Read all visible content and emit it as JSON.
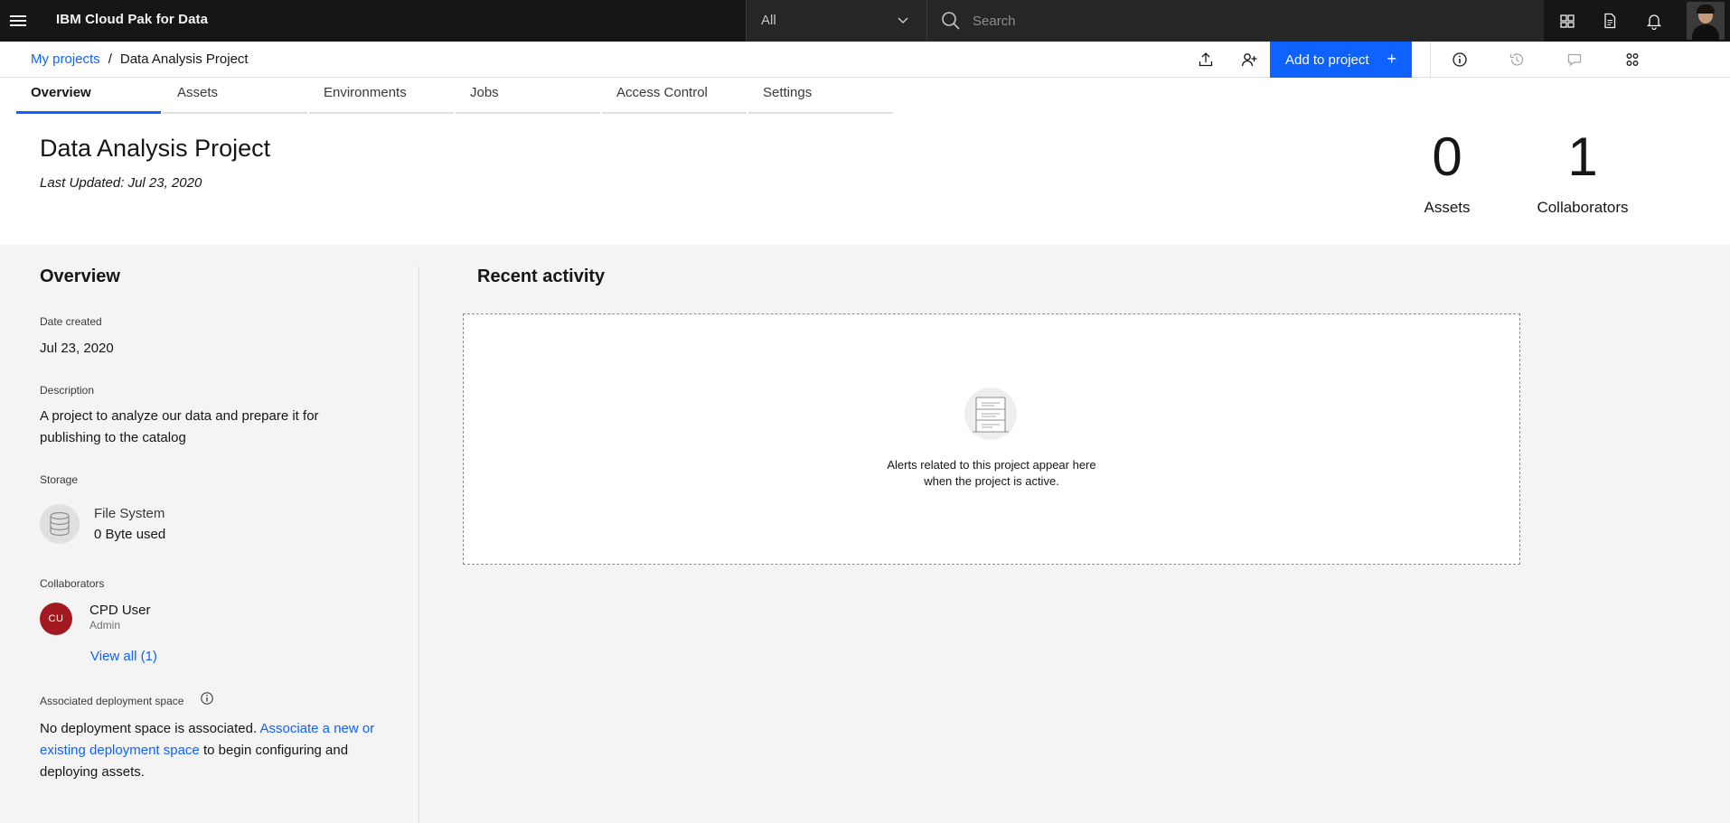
{
  "header": {
    "app_title": "IBM Cloud Pak for Data",
    "scope_select": {
      "selected": "All"
    },
    "search": {
      "placeholder": "Search",
      "value": ""
    },
    "icons": [
      "menu-icon",
      "catalog-icon",
      "document-icon",
      "notification-icon",
      "user-avatar"
    ]
  },
  "breadcrumb": {
    "root": "My projects",
    "separator": "/",
    "current": "Data Analysis Project"
  },
  "toolbar": {
    "add_button_label": "Add to project",
    "add_button_icon": "+",
    "icons": [
      "export-icon",
      "add-collaborator-icon",
      "info-icon",
      "history-icon",
      "chat-icon",
      "settings-icon"
    ]
  },
  "tabs": [
    {
      "label": "Overview",
      "active": true
    },
    {
      "label": "Assets",
      "active": false
    },
    {
      "label": "Environments",
      "active": false
    },
    {
      "label": "Jobs",
      "active": false
    },
    {
      "label": "Access Control",
      "active": false
    },
    {
      "label": "Settings",
      "active": false
    }
  ],
  "project": {
    "title": "Data Analysis Project",
    "last_updated": "Last Updated: Jul 23, 2020",
    "stats": {
      "assets": {
        "value": "0",
        "label": "Assets"
      },
      "collaborators": {
        "value": "1",
        "label": "Collaborators"
      }
    }
  },
  "overview": {
    "title": "Overview",
    "date_created": {
      "label": "Date created",
      "value": "Jul 23, 2020"
    },
    "description": {
      "label": "Description",
      "line1": "A project to analyze our data and prepare it for",
      "line2": "publishing to the catalog"
    },
    "storage": {
      "label": "Storage",
      "type": "File System",
      "usage": "0 Byte used"
    },
    "collaborators": {
      "label": "Collaborators",
      "items": [
        {
          "initials": "CU",
          "name": "CPD User",
          "role": "Admin"
        }
      ],
      "view_all": "View all (1)"
    },
    "deployment_space": {
      "label": "Associated deployment space",
      "text_before": "No deployment space is associated.",
      "link_line1": "Associate a new or",
      "link_line2": "existing deployment space",
      "text_after_1": "to begin configuring and",
      "text_after_2": "deploying assets."
    }
  },
  "recent_activity": {
    "title": "Recent activity",
    "empty_line1": "Alerts related to this project appear here",
    "empty_line2": "when the project is active."
  },
  "colors": {
    "header_bg": "#161616",
    "primary": "#0f62fe",
    "avatar_bg": "#a2191f",
    "content_bg": "#f4f4f4"
  }
}
